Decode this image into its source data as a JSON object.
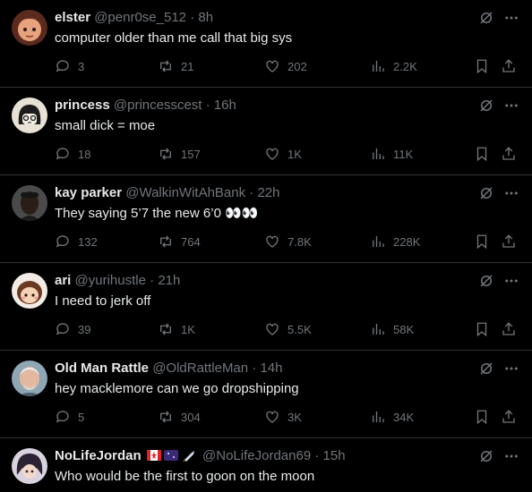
{
  "posts": [
    {
      "name": "elster",
      "handle": "@penr0se_512",
      "dot": "·",
      "time": "8h",
      "text": "computer older than me call that big sys",
      "replies": "3",
      "reposts": "21",
      "likes": "202",
      "views": "2.2K",
      "avatar_color": "#7a3b2a"
    },
    {
      "name": "princess",
      "handle": "@princesscest",
      "dot": "·",
      "time": "16h",
      "text": "small dick = moe",
      "replies": "18",
      "reposts": "157",
      "likes": "1K",
      "views": "11K",
      "avatar_color": "#e8e2d6"
    },
    {
      "name": "kay parker",
      "handle": "@WalkinWitAhBank",
      "dot": "·",
      "time": "22h",
      "text": "They saying 5’7 the new 6’0 👀👀",
      "replies": "132",
      "reposts": "764",
      "likes": "7.8K",
      "views": "228K",
      "avatar_color": "#3a3a3a"
    },
    {
      "name": "ari",
      "handle": "@yurihustle",
      "dot": "·",
      "time": "21h",
      "text": "I need to jerk off",
      "replies": "39",
      "reposts": "1K",
      "likes": "5.5K",
      "views": "58K",
      "avatar_color": "#f3ece6"
    },
    {
      "name": "Old Man Rattle",
      "handle": "@OldRattleMan",
      "dot": "·",
      "time": "14h",
      "text": "hey macklemore can we go dropshipping",
      "replies": "5",
      "reposts": "304",
      "likes": "3K",
      "views": "34K",
      "avatar_color": "#8fa6b5"
    },
    {
      "name": "NoLifeJordan",
      "handle": "@NoLifeJordan69",
      "dot": "·",
      "time": "15h",
      "text": "Who would be the first to goon on the moon",
      "avatar_color": "#d9d3df"
    }
  ],
  "colors": {
    "background": "#000000",
    "text": "#e7e9ea",
    "muted": "#71767b",
    "divider": "#2f3336"
  },
  "icons": [
    "grok-icon",
    "more-icon",
    "reply-icon",
    "repost-icon",
    "like-icon",
    "views-icon",
    "bookmark-icon",
    "share-icon"
  ]
}
